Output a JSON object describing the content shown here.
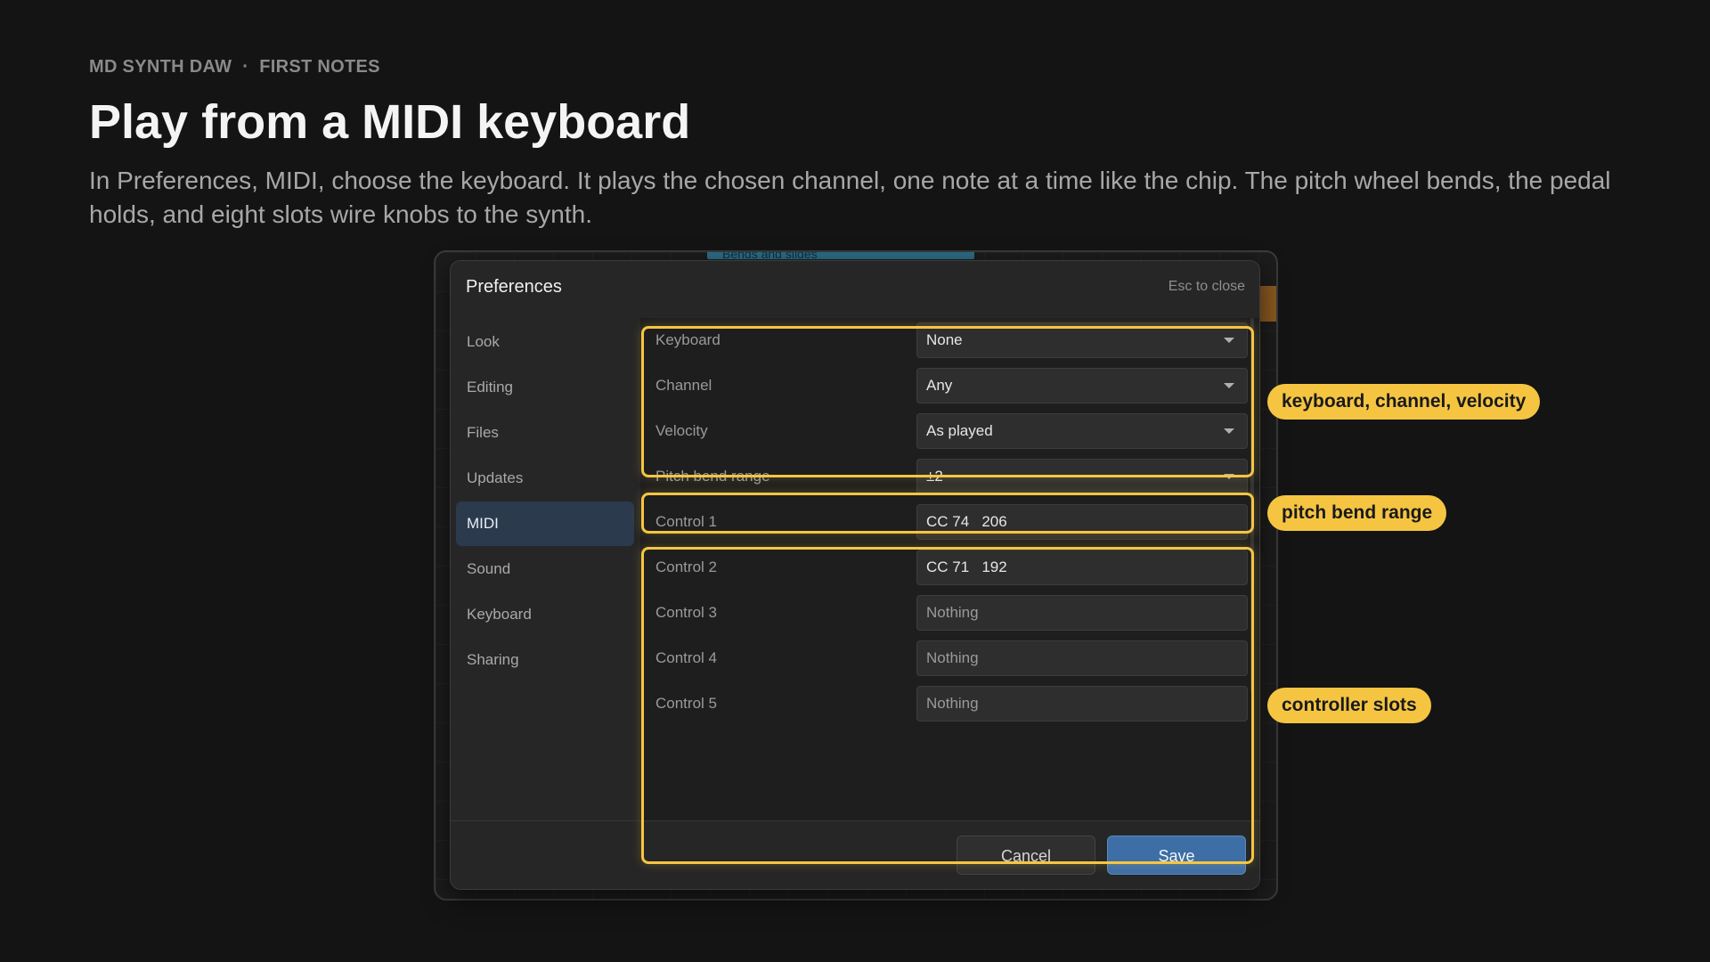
{
  "header": {
    "eyebrow_app": "MD SYNTH DAW",
    "eyebrow_sep": "·",
    "eyebrow_section": "FIRST NOTES",
    "title": "Play from a MIDI keyboard",
    "description": "In Preferences, MIDI, choose the keyboard. It plays the chosen channel, one note at a time like the chip. The pitch wheel bends, the pedal holds, and eight slots wire knobs to the synth."
  },
  "background": {
    "clip_label": "Bends and slides"
  },
  "dialog": {
    "title": "Preferences",
    "esc_hint": "Esc to close",
    "nav": [
      {
        "label": "Look",
        "active": false
      },
      {
        "label": "Editing",
        "active": false
      },
      {
        "label": "Files",
        "active": false
      },
      {
        "label": "Updates",
        "active": false
      },
      {
        "label": "MIDI",
        "active": true
      },
      {
        "label": "Sound",
        "active": false
      },
      {
        "label": "Keyboard",
        "active": false
      },
      {
        "label": "Sharing",
        "active": false
      }
    ],
    "settings": {
      "keyboard": {
        "label": "Keyboard",
        "value": "None"
      },
      "channel": {
        "label": "Channel",
        "value": "Any"
      },
      "velocity": {
        "label": "Velocity",
        "value": "As played"
      },
      "pitch_bend": {
        "label": "Pitch bend range",
        "value": "±2"
      },
      "controls": [
        {
          "label": "Control 1",
          "value": "CC 74   206"
        },
        {
          "label": "Control 2",
          "value": "CC 71   192"
        },
        {
          "label": "Control 3",
          "value": "Nothing"
        },
        {
          "label": "Control 4",
          "value": "Nothing"
        },
        {
          "label": "Control 5",
          "value": "Nothing"
        }
      ]
    },
    "buttons": {
      "cancel": "Cancel",
      "save": "Save"
    }
  },
  "callouts": {
    "group1": "keyboard, channel, velocity",
    "group2": "pitch bend range",
    "group3": "controller slots"
  },
  "colors": {
    "highlight": "#f5c542",
    "active_nav": "#2b3a4d",
    "save_button": "#3d6ea6"
  }
}
